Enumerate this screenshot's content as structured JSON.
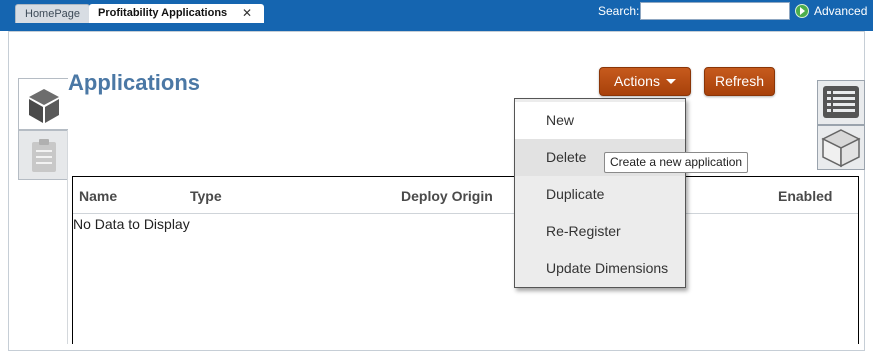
{
  "tabs": [
    {
      "label": "HomePage",
      "active": false
    },
    {
      "label": "Profitability Applications",
      "active": true,
      "close_glyph": "✕"
    }
  ],
  "search": {
    "label": "Search:",
    "value": "",
    "placeholder": ""
  },
  "advanced": {
    "label": "Advanced",
    "icon": "go-arrow-icon"
  },
  "page": {
    "title": "Applications"
  },
  "buttons": {
    "actions": "Actions",
    "refresh": "Refresh"
  },
  "side_tabs": {
    "left": [
      {
        "icon": "cube-icon",
        "active": true
      },
      {
        "icon": "clipboard-icon",
        "active": false
      }
    ],
    "right": [
      {
        "icon": "list-view-icon"
      },
      {
        "icon": "outline-cube-icon"
      }
    ]
  },
  "table": {
    "columns": [
      "Name",
      "Type",
      "Deploy Origin",
      "Enabled"
    ],
    "rows": [],
    "empty_text": "No Data to Display"
  },
  "actions_menu": {
    "items": [
      "New",
      "Delete",
      "Duplicate",
      "Re-Register",
      "Update Dimensions"
    ]
  },
  "tooltip": {
    "text": "Create a new application"
  },
  "colors": {
    "header_blue": "#1565b0",
    "title_blue": "#4b78a5",
    "button_orange": "#b54d12"
  }
}
